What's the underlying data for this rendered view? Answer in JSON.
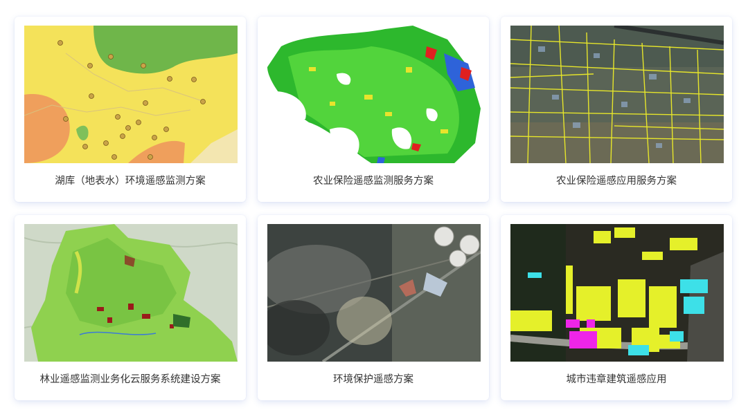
{
  "solutions": [
    {
      "title": "湖库（地表水）环境遥感监测方案",
      "image": "lake-water-quality-map"
    },
    {
      "title": "农业保险遥感监测服务方案",
      "image": "agriculture-crop-classification-map"
    },
    {
      "title": "农业保险遥感应用服务方案",
      "image": "farmland-parcel-satellite-image"
    },
    {
      "title": "林业遥感监测业务化云服务系统建设方案",
      "image": "forestry-land-cover-map"
    },
    {
      "title": "环境保护遥感方案",
      "image": "industrial-smoke-satellite-image"
    },
    {
      "title": "城市违章建筑遥感应用",
      "image": "urban-illegal-building-detection-image"
    }
  ],
  "colors": {
    "card_background": "#ffffff",
    "card_shadow": "#4664c8",
    "caption_text": "#333333"
  }
}
